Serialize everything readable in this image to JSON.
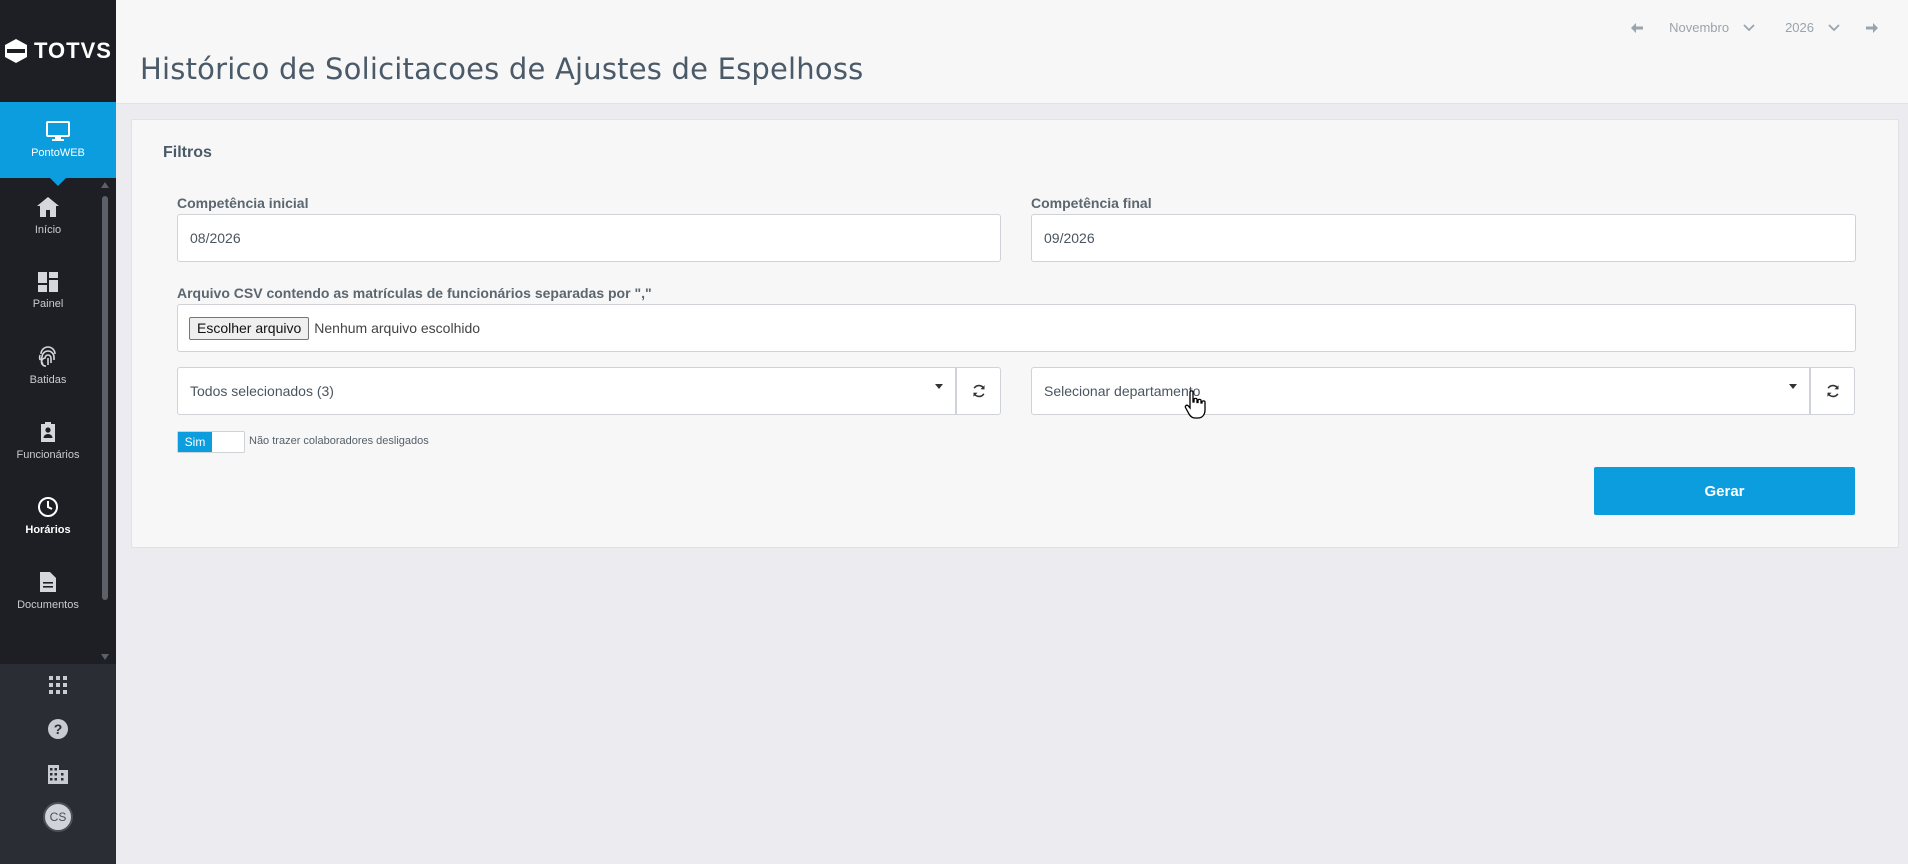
{
  "sidebar": {
    "logo_text": "TOTVS",
    "active_app": {
      "label": "PontoWEB",
      "icon": "monitor-icon"
    },
    "items": [
      {
        "label": "Início",
        "icon": "home-icon"
      },
      {
        "label": "Painel",
        "icon": "dashboard-icon"
      },
      {
        "label": "Batidas",
        "icon": "fingerprint-icon"
      },
      {
        "label": "Funcionários",
        "icon": "badge-icon"
      },
      {
        "label": "Horários",
        "icon": "clock-icon"
      },
      {
        "label": "Documentos",
        "icon": "document-icon"
      }
    ],
    "bottom_tools": [
      {
        "icon": "apps-grid-icon"
      },
      {
        "icon": "help-icon"
      },
      {
        "icon": "building-icon"
      }
    ],
    "user_initials": "CS"
  },
  "header": {
    "title": "Histórico de Solicitacoes de Ajustes de Espelhoss",
    "month": "Novembro",
    "year": "2026"
  },
  "filters": {
    "title": "Filtros",
    "competencia_inicial": {
      "label": "Competência inicial",
      "value": "08/2026"
    },
    "competencia_final": {
      "label": "Competência final",
      "value": "09/2026"
    },
    "csv": {
      "label": "Arquivo CSV contendo as matrículas de funcionários separadas por \",\"",
      "button": "Escolher arquivo",
      "status": "Nenhum arquivo escolhido"
    },
    "select_funcionarios": {
      "value": "Todos selecionados (3)"
    },
    "select_departamento": {
      "value": "Selecionar departamento"
    },
    "toggle": {
      "on_label": "Sim",
      "label": "Não trazer colaboradores desligados",
      "state": true
    },
    "submit_label": "Gerar"
  },
  "colors": {
    "accent": "#0c9ddf",
    "sidebar_bg": "#1d1f24",
    "page_bg": "#ececf0"
  }
}
